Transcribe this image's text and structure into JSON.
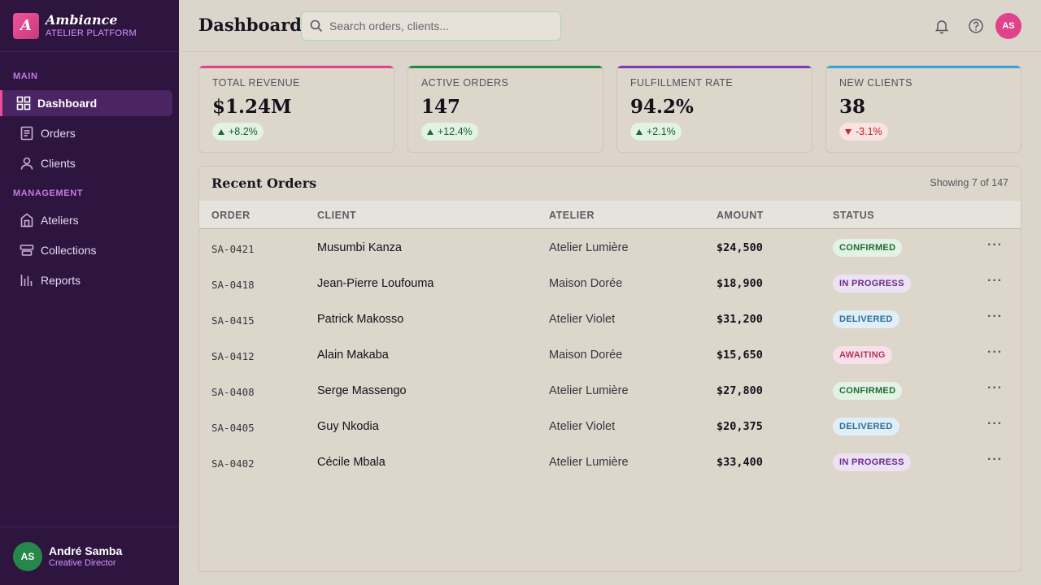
{
  "brand": {
    "name": "Ambiance",
    "subtitle": "ATELIER PLATFORM",
    "logo_letter": "A"
  },
  "sidebar": {
    "sections": [
      {
        "label": "MAIN"
      },
      {
        "label": "MANAGEMENT"
      }
    ],
    "items": [
      {
        "label": "Dashboard",
        "icon": "dashboard-icon",
        "active": true
      },
      {
        "label": "Orders",
        "icon": "orders-icon"
      },
      {
        "label": "Clients",
        "icon": "user-icon"
      },
      {
        "label": "Ateliers",
        "icon": "building-icon"
      },
      {
        "label": "Collections",
        "icon": "collections-icon"
      },
      {
        "label": "Reports",
        "icon": "bar-chart-icon"
      }
    ],
    "user": {
      "initials": "AS",
      "name": "André Samba",
      "role": "Creative Director"
    }
  },
  "header": {
    "title": "Dashboard",
    "search_placeholder": "Search orders, clients...",
    "avatar_initials": "AS"
  },
  "stats": [
    {
      "label": "TOTAL REVENUE",
      "value": "$1.24M",
      "change": "+8.2%",
      "trend": "up",
      "accent": "#e0438c"
    },
    {
      "label": "ACTIVE ORDERS",
      "value": "147",
      "change": "+12.4%",
      "trend": "up",
      "accent": "#1f8a45"
    },
    {
      "label": "FULFILLMENT RATE",
      "value": "94.2%",
      "change": "+2.1%",
      "trend": "up",
      "accent": "#7a3cb8"
    },
    {
      "label": "NEW CLIENTS",
      "value": "38",
      "change": "-3.1%",
      "trend": "down",
      "accent": "#3aa0dc"
    }
  ],
  "orders": {
    "title": "Recent Orders",
    "count_text": "Showing 7 of 147",
    "columns": [
      "ORDER",
      "CLIENT",
      "ATELIER",
      "AMOUNT",
      "STATUS"
    ],
    "rows": [
      {
        "order": "SA-0421",
        "client": "Musumbi Kanza",
        "atelier": "Atelier Lumière",
        "amount": "$24,500",
        "status": "CONFIRMED"
      },
      {
        "order": "SA-0418",
        "client": "Jean-Pierre Loufouma",
        "atelier": "Maison Dorée",
        "amount": "$18,900",
        "status": "IN PROGRESS"
      },
      {
        "order": "SA-0415",
        "client": "Patrick Makosso",
        "atelier": "Atelier Violet",
        "amount": "$31,200",
        "status": "DELIVERED"
      },
      {
        "order": "SA-0412",
        "client": "Alain Makaba",
        "atelier": "Maison Dorée",
        "amount": "$15,650",
        "status": "AWAITING"
      },
      {
        "order": "SA-0408",
        "client": "Serge Massengo",
        "atelier": "Atelier Lumière",
        "amount": "$27,800",
        "status": "CONFIRMED"
      },
      {
        "order": "SA-0405",
        "client": "Guy Nkodia",
        "atelier": "Atelier Violet",
        "amount": "$20,375",
        "status": "DELIVERED"
      },
      {
        "order": "SA-0402",
        "client": "Cécile Mbala",
        "atelier": "Atelier Lumière",
        "amount": "$33,400",
        "status": "IN PROGRESS"
      }
    ]
  }
}
